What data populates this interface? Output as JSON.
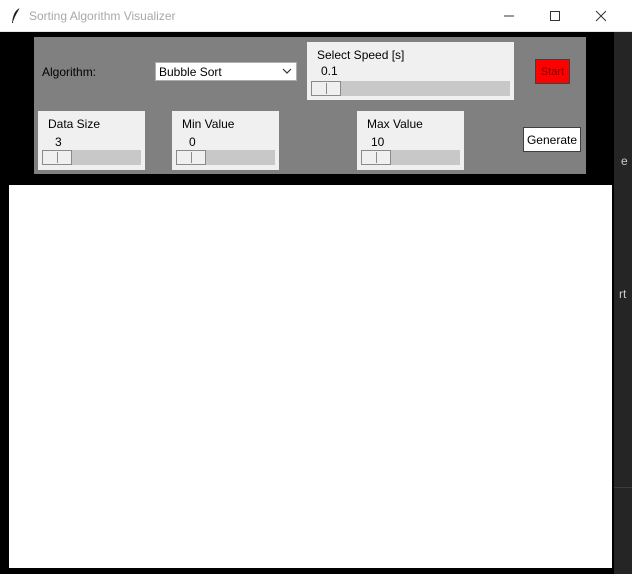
{
  "window": {
    "title": "Sorting Algorithm Visualizer",
    "controls": [
      "minimize-icon",
      "maximize-icon",
      "close-icon"
    ]
  },
  "background_fragments": [
    "e",
    "rt"
  ],
  "algorithm": {
    "label": "Algorithm:",
    "selected": "Bubble Sort"
  },
  "speed": {
    "title": "Select Speed [s]",
    "value": "0.1",
    "level": 0.0
  },
  "data_size": {
    "title": "Data Size",
    "value": "3",
    "level": 0.0
  },
  "min_value": {
    "title": "Min Value",
    "value": "0",
    "level": 0.0
  },
  "max_value": {
    "title": "Max Value",
    "value": "10",
    "level": 0.0
  },
  "buttons": {
    "start": "Start",
    "generate": "Generate"
  },
  "colors": {
    "panel": "#808080",
    "start_button": "#ff0000",
    "canvas": "#ffffff",
    "window_bg": "#000000"
  }
}
